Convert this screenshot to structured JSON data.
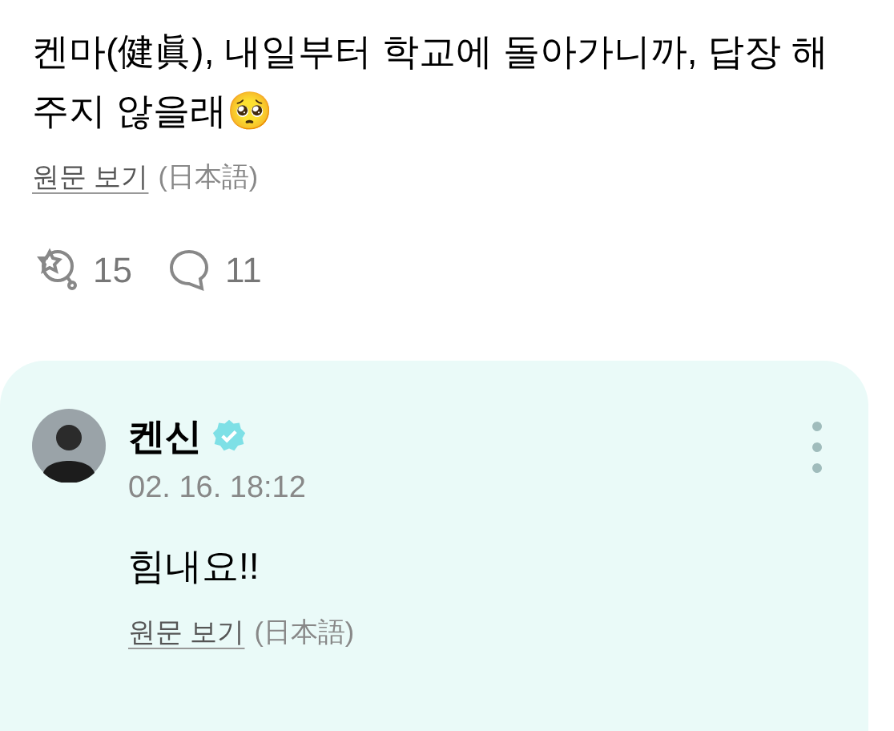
{
  "post": {
    "text": "켄마(健眞), 내일부터 학교에 돌아가니까, 답장 해주지 않을래🥺",
    "translate_link": "원문 보기",
    "language": "(日本語)",
    "reactions": "15",
    "comments": "11"
  },
  "reply": {
    "author": "켄신",
    "verified": true,
    "time": "02. 16. 18:12",
    "text": "힘내요!!",
    "translate_link": "원문 보기",
    "language": "(日本語)"
  }
}
